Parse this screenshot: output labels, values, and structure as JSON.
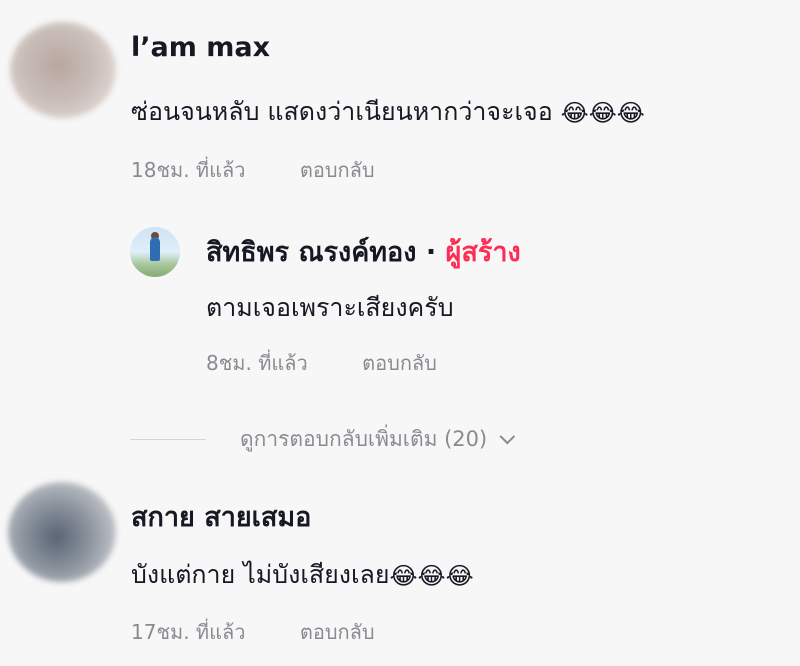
{
  "comments": [
    {
      "username": "l’am max",
      "text": "ซ่อนจนหลับ แสดงว่าเนียนหากว่าจะเจอ",
      "emoji": "😂😂😂",
      "time": "18ชม. ที่แล้ว",
      "reply_label": "ตอบกลับ"
    },
    {
      "username": "สกาย สายเสมอ",
      "text": "บังแต่กาย ไม่บังเสียงเลย",
      "emoji": "😂😂😂",
      "time": "17ชม. ที่แล้ว",
      "reply_label": "ตอบกลับ"
    }
  ],
  "reply": {
    "username": "สิทธิพร ณรงค์ทอง",
    "separator": "·",
    "creator_tag": "ผู้สร้าง",
    "text": "ตามเจอเพราะเสียงครับ",
    "time": "8ชม. ที่แล้ว",
    "reply_label": "ตอบกลับ"
  },
  "more_replies": {
    "label": "ดูการตอบกลับเพิ่มเติม (20)"
  },
  "colors": {
    "creator_accent": "#fe2c55",
    "meta_text": "#8a8b91",
    "background": "#f7f7f7"
  }
}
